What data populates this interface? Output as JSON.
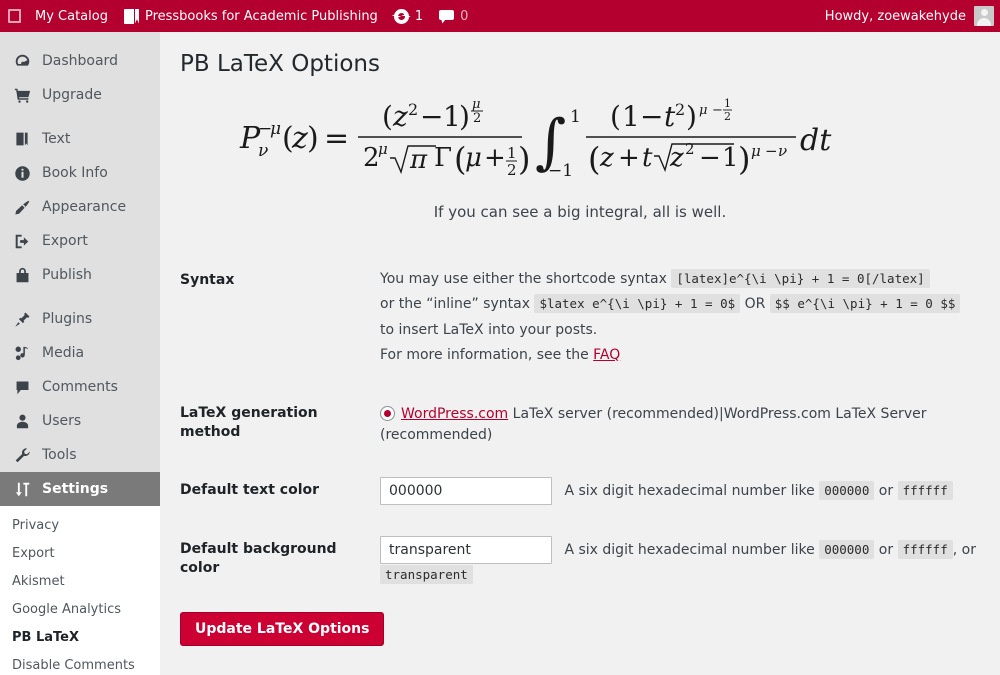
{
  "adminbar": {
    "logo_icon": "square-icon",
    "catalog_label": "My Catalog",
    "book_icon": "book-icon",
    "site_label": "Pressbooks for Academic Publishing",
    "updates_icon": "updates-icon",
    "updates_count": "1",
    "comments_icon": "comment-bubble-icon",
    "comments_count": "0",
    "howdy": "Howdy, zoewakehyde",
    "avatar_icon": "avatar-icon"
  },
  "sidebar": {
    "items": [
      {
        "label": "Dashboard",
        "icon": "dashboard-icon",
        "active": false
      },
      {
        "label": "Upgrade",
        "icon": "cart-icon",
        "active": false
      },
      {
        "label": "Text",
        "icon": "book-icon",
        "active": false
      },
      {
        "label": "Book Info",
        "icon": "info-icon",
        "active": false
      },
      {
        "label": "Appearance",
        "icon": "brush-icon",
        "active": false
      },
      {
        "label": "Export",
        "icon": "export-icon",
        "active": false
      },
      {
        "label": "Publish",
        "icon": "store-icon",
        "active": false
      },
      {
        "label": "Plugins",
        "icon": "plug-icon",
        "active": false
      },
      {
        "label": "Media",
        "icon": "media-icon",
        "active": false
      },
      {
        "label": "Comments",
        "icon": "comment-bubble-icon",
        "active": false
      },
      {
        "label": "Users",
        "icon": "user-icon",
        "active": false
      },
      {
        "label": "Tools",
        "icon": "wrench-icon",
        "active": false
      },
      {
        "label": "Settings",
        "icon": "settings-sliders-icon",
        "active": true
      }
    ],
    "submenu": [
      {
        "label": "Privacy",
        "current": false
      },
      {
        "label": "Export",
        "current": false
      },
      {
        "label": "Akismet",
        "current": false
      },
      {
        "label": "Google Analytics",
        "current": false
      },
      {
        "label": "PB LaTeX",
        "current": true
      },
      {
        "label": "Disable Comments",
        "current": false
      }
    ]
  },
  "main": {
    "title": "PB LaTeX Options",
    "formula_caption": "If you can see a big integral, all is well.",
    "formula_latex": "P_\\nu^{-\\mu}(z) = \\frac{(z^2-1)^{\\frac{\\mu}{2}}}{2^\\mu \\sqrt{\\pi} \\Gamma\\left(\\mu+\\frac{1}{2}\\right)} \\int_{-1}^{1} \\frac{(1-t^2)^{\\mu-\\frac{1}{2}}}{(z+t\\sqrt{z^2-1})^{\\mu-\\nu}} dt",
    "syntax": {
      "label": "Syntax",
      "line1_pre": "You may use either the shortcode syntax",
      "code_shortcode": "[latex]e^{\\i \\pi} + 1 = 0[/latex]",
      "line2_pre": "or the “inline” syntax",
      "code_inline1": "$latex e^{\\i \\pi} + 1 = 0$",
      "or_label": "OR",
      "code_inline2": "$$ e^{\\i \\pi} + 1 = 0 $$",
      "line3": "to insert LaTeX into your posts.",
      "line4_pre": "For more information, see the",
      "faq_link": "FAQ"
    },
    "generation_method": {
      "label": "LaTeX generation method",
      "option_link": "WordPress.com",
      "option_rest": " LaTeX server (recommended)|WordPress.com LaTeX Server (recommended)",
      "selected": true
    },
    "text_color": {
      "label": "Default text color",
      "value": "000000",
      "desc_pre": "A six digit hexadecimal number like",
      "code_a": "000000",
      "desc_or": "or",
      "code_b": "ffffff"
    },
    "background_color": {
      "label": "Default background color",
      "value": "transparent",
      "desc_pre": "A six digit hexadecimal number like",
      "code_a": "000000",
      "desc_or": "or",
      "code_b": "ffffff",
      "desc_tail": ", or",
      "code_c": "transparent"
    },
    "submit_label": "Update LaTeX Options"
  },
  "colors": {
    "brand_red": "#b4002f",
    "button_red": "#cc0033",
    "sidebar_bg": "#e0e0e0",
    "active_menu_bg": "#7a7a7a",
    "content_bg": "#f1f1f1"
  }
}
